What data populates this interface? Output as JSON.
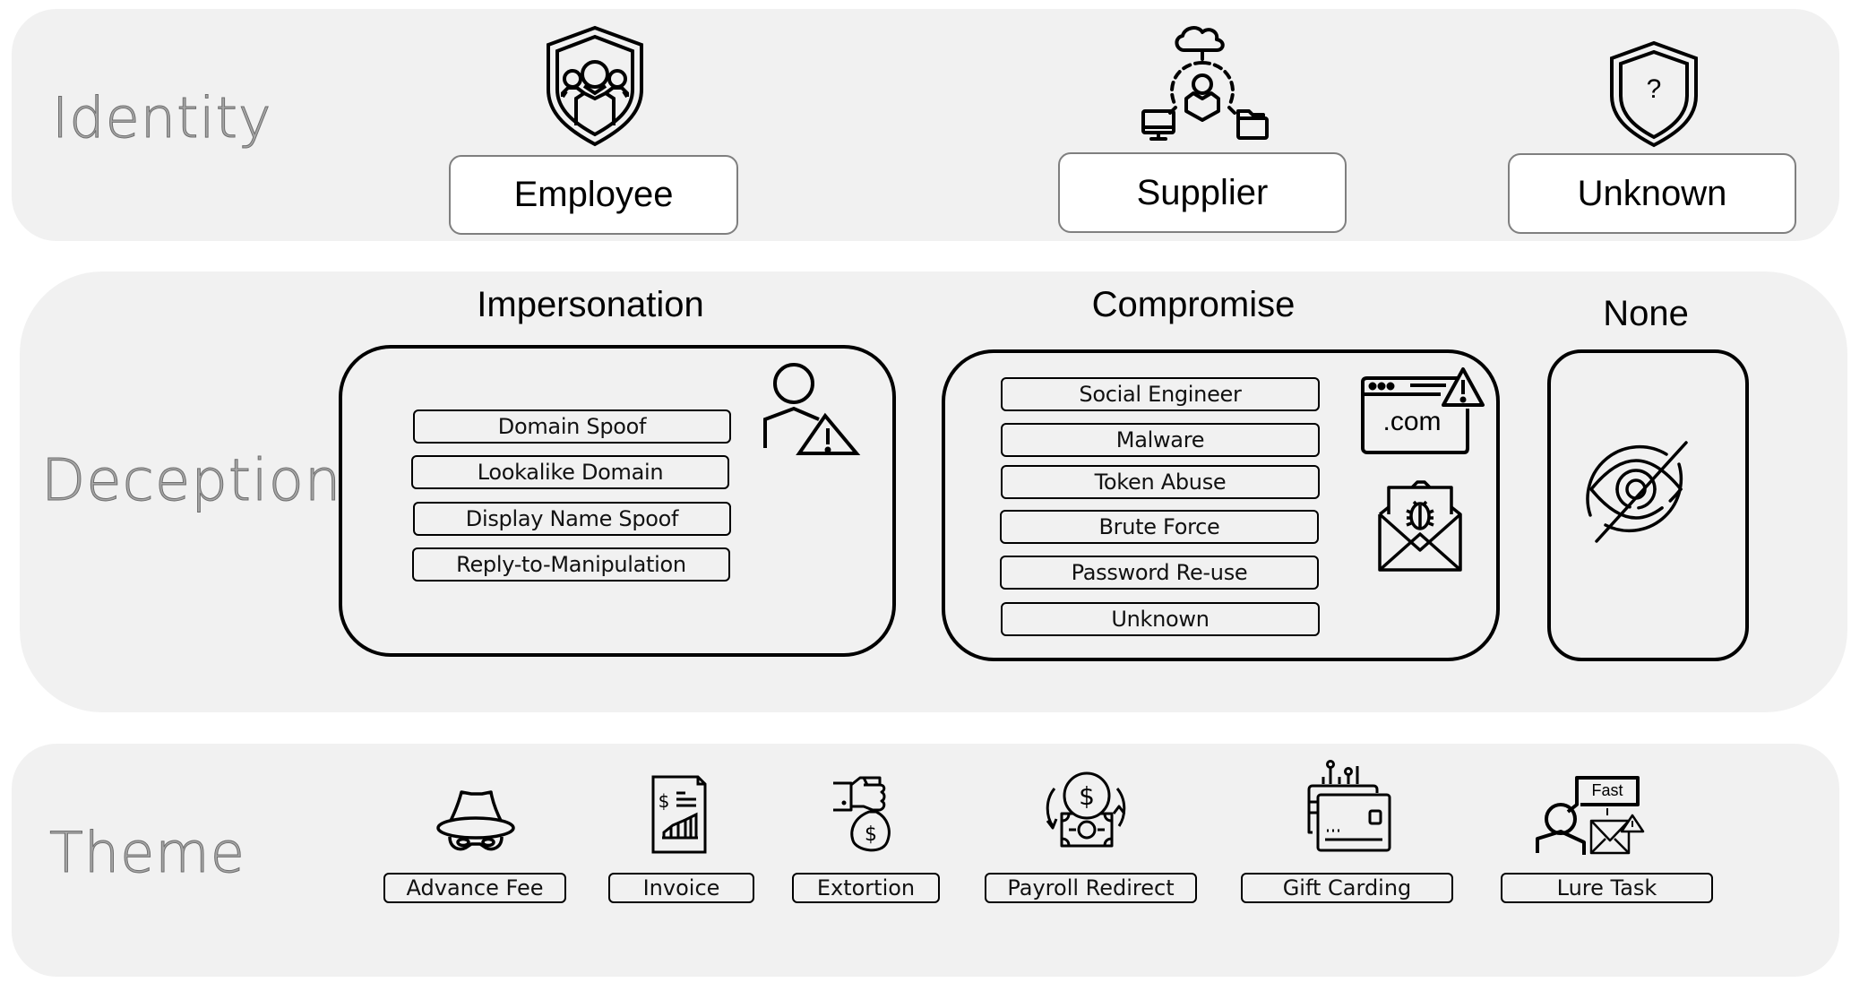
{
  "identity": {
    "label": "Identity",
    "items": [
      {
        "label": "Employee",
        "icon": "employee-shield-icon"
      },
      {
        "label": "Supplier",
        "icon": "supplier-network-icon"
      },
      {
        "label": "Unknown",
        "icon": "unknown-shield-icon"
      }
    ]
  },
  "deception": {
    "label": "Deception",
    "groups": [
      {
        "title": "Impersonation",
        "icon": "person-warning-icon",
        "items": [
          "Domain Spoof",
          "Lookalike Domain",
          "Display Name Spoof",
          "Reply-to-Manipulation"
        ]
      },
      {
        "title": "Compromise",
        "icons": [
          "website-warning-icon",
          "malware-envelope-icon"
        ],
        "icon_text": ".com",
        "items": [
          "Social Engineer",
          "Malware",
          "Token Abuse",
          "Brute Force",
          "Password Re-use",
          "Unknown"
        ]
      },
      {
        "title": "None",
        "icon": "eye-slash-icon",
        "items": []
      }
    ]
  },
  "theme": {
    "label": "Theme",
    "items": [
      {
        "label": "Advance Fee",
        "icon": "masked-spy-icon"
      },
      {
        "label": "Invoice",
        "icon": "invoice-document-icon"
      },
      {
        "label": "Extortion",
        "icon": "hand-money-bag-icon"
      },
      {
        "label": "Payroll Redirect",
        "icon": "payroll-cycle-icon"
      },
      {
        "label": "Gift Carding",
        "icon": "gift-cards-icon"
      },
      {
        "label": "Lure Task",
        "icon": "person-message-icon",
        "icon_text": "Fast"
      }
    ]
  }
}
